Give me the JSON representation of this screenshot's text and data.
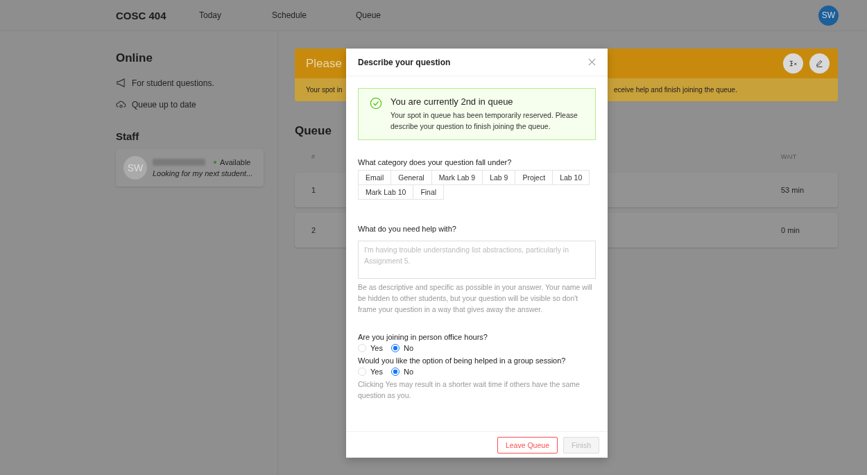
{
  "nav": {
    "course": "COSC 404",
    "links": [
      "Today",
      "Schedule",
      "Queue"
    ],
    "avatar": "SW"
  },
  "sidebar": {
    "title": "Online",
    "info": [
      {
        "kind": "megaphone",
        "text": "For student questions."
      },
      {
        "kind": "cloud",
        "text": "Queue up to date"
      }
    ],
    "staff_title": "Staff",
    "staff": [
      {
        "avatar": "SW",
        "status": "Available",
        "message": "Looking for my next student..."
      }
    ]
  },
  "banner": {
    "title": "Please",
    "message_start": "Your spot in",
    "message_end": "eceive help and finish joining the queue."
  },
  "queue": {
    "title": "Queue",
    "columns": [
      "#",
      "WAIT"
    ],
    "rows": [
      {
        "number": "1",
        "wait": "53 min"
      },
      {
        "number": "2",
        "wait": "0 min"
      }
    ]
  },
  "modal": {
    "title": "Describe your question",
    "alert": {
      "title": "You are currently 2nd in queue",
      "text": "Your spot in queue has been temporarily reserved. Please describe your question to finish joining the queue."
    },
    "category_label": "What category does your question fall under?",
    "categories": [
      {
        "label": "Email",
        "selected": false
      },
      {
        "label": "General",
        "selected": false
      },
      {
        "label": "Mark Lab 9",
        "selected": false
      },
      {
        "label": "Lab 9",
        "selected": false
      },
      {
        "label": "Project",
        "selected": false
      },
      {
        "label": "Lab 10",
        "selected": false
      },
      {
        "label": "Mark Lab 10",
        "selected": false
      },
      {
        "label": "Final",
        "selected": false
      }
    ],
    "help_label": "What do you need help with?",
    "help_placeholder": "I'm having trouble understanding list abstractions, particularly in Assignment 5.",
    "help_hint": "Be as descriptive and specific as possible in your answer. Your name will be hidden to other students, but your question will be visible so don't frame your question in a way that gives away the answer.",
    "questions": [
      {
        "label": "Are you joining in person office hours?",
        "options": [
          {
            "label": "Yes",
            "selected": false
          },
          {
            "label": "No",
            "selected": true
          }
        ]
      },
      {
        "label": "Would you like the option of being helped in a group session?",
        "options": [
          {
            "label": "Yes",
            "selected": false
          },
          {
            "label": "No",
            "selected": true
          }
        ],
        "hint": "Clicking Yes may result in a shorter wait time if others have the same question as you."
      }
    ],
    "buttons": [
      {
        "kind": "danger",
        "label": "Leave Queue",
        "disabled": false
      },
      {
        "kind": "primary",
        "label": "Finish",
        "disabled": true
      }
    ]
  }
}
